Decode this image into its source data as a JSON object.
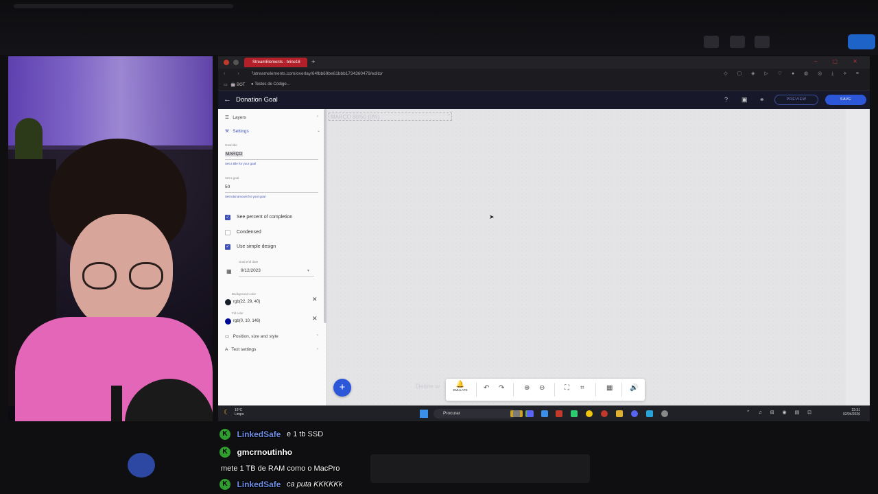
{
  "browser": {
    "tab_title": "StreamElements - brine18",
    "url": "streamelements.com/overlay/64fbb69be61bbb1734360479/editor",
    "bookmarks": [
      "BOT",
      "Testes de Código..."
    ]
  },
  "app": {
    "title": "Donation Goal",
    "preview_label": "PREVIEW",
    "save_label": "SAVE"
  },
  "sidebar": {
    "layers_label": "Layers",
    "settings_label": "Settings",
    "goal_title": {
      "label": "Goal title",
      "value": "MARÇO",
      "help": "Set a title for your goal"
    },
    "goal_amount": {
      "label": "Set a goal",
      "value": "50",
      "help": "Set total amount for your goal"
    },
    "checkboxes": [
      {
        "label": "See percent of completion",
        "checked": true
      },
      {
        "label": "Condensed",
        "checked": false
      },
      {
        "label": "Use simple design",
        "checked": true
      }
    ],
    "end_date": {
      "label": "Goal end date",
      "value": "9/12/2023"
    },
    "background_color": {
      "label": "Background color",
      "value": "rgb(22, 29, 40)",
      "swatch": "#161d28"
    },
    "fill_color": {
      "label": "Fill color",
      "value": "rgb(0, 10, 146)",
      "swatch": "#000a92"
    },
    "position_label": "Position, size and style",
    "text_settings_label": "Text settings"
  },
  "canvas": {
    "goal_preview_text": "MARÇO 80/50 (0%)",
    "faded_text": "Delete w"
  },
  "toolbar": {
    "emulate_label": "EMULATE"
  },
  "taskbar": {
    "temperature": "16°C",
    "weather": "Limpo",
    "search_placeholder": "Procurar",
    "time": "22:31",
    "date": "02/04/2026"
  },
  "chat": [
    {
      "user": "LinkedSafe",
      "message": "e 1 tb SSD",
      "user_color": "blue",
      "italic": false
    },
    {
      "user": "gmcrnoutinho",
      "message": "",
      "user_color": "white",
      "italic": false
    },
    {
      "user": "",
      "message": "mete 1 TB de RAM como o MacPro",
      "user_color": "white",
      "italic": false
    },
    {
      "user": "LinkedSafe",
      "message": "ca puta KKKKKk",
      "user_color": "blue",
      "italic": true
    }
  ],
  "colors": {
    "accent": "#3f51b5",
    "save_button": "#2c57d8",
    "header_bg": "#17182a",
    "tab_red": "#b4202a"
  }
}
